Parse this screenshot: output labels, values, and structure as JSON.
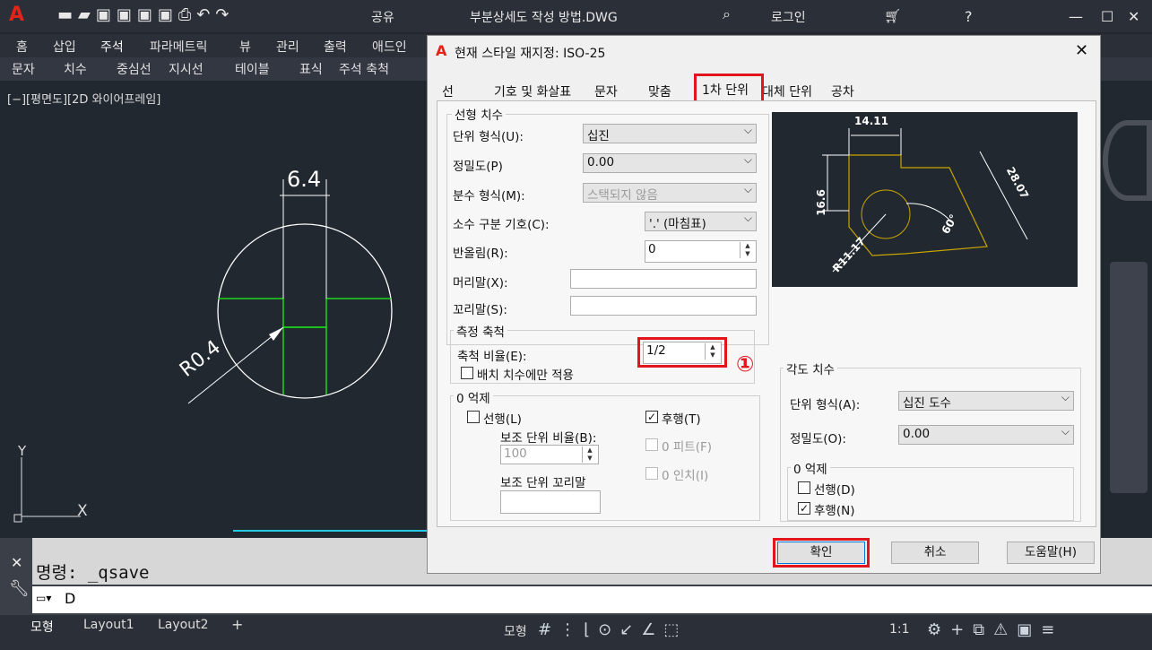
{
  "titlebar": {
    "app_logo": "A",
    "share": "공유",
    "filename": "부분상세도 작성 방법.DWG",
    "login": "로그인"
  },
  "ribbon": {
    "tabs": [
      "홈",
      "삽입",
      "주석",
      "파라메트릭",
      "뷰",
      "관리",
      "출력",
      "애드인"
    ],
    "panels": [
      "문자",
      "치수",
      "중심선",
      "지시선",
      "테이블",
      "표식",
      "주석 축척"
    ]
  },
  "viewport": {
    "label": "[−][평면도][2D 와이어프레임]",
    "dim_top": "6.4",
    "dim_radius": "R0.4",
    "axis_y": "Y",
    "axis_x": "X"
  },
  "command": {
    "history": "명령: _qsave",
    "input": "D"
  },
  "status": {
    "tabs": [
      "모형",
      "Layout1",
      "Layout2",
      "+"
    ],
    "model": "모형",
    "scale": "1:1"
  },
  "dialog": {
    "title": "현재 스타일 재지정: ISO-25",
    "tabs": [
      "선",
      "기호 및 화살표",
      "문자",
      "맞춤",
      "1차 단위",
      "대체 단위",
      "공차"
    ],
    "linear": {
      "title": "선형 치수",
      "unit_format_label": "단위 형식(U):",
      "unit_format": "십진",
      "precision_label": "정밀도(P)",
      "precision": "0.00",
      "fraction_label": "분수 형식(M):",
      "fraction": "스택되지 않음",
      "decimal_sep_label": "소수 구분 기호(C):",
      "decimal_sep": "'.' (마침표)",
      "roundoff_label": "반올림(R):",
      "roundoff": "0",
      "prefix_label": "머리말(X):",
      "suffix_label": "꼬리말(S):"
    },
    "scale": {
      "title": "측정 축척",
      "factor_label": "축척 비율(E):",
      "factor": "1/2",
      "layout_only": "배치 치수에만 적용",
      "marker": "①"
    },
    "zero": {
      "title": "0 억제",
      "leading": "선행(L)",
      "trailing": "후행(T)",
      "sub_factor_label": "보조 단위 비율(B):",
      "sub_factor": "100",
      "feet": "0 피트(F)",
      "inches": "0 인치(I)",
      "sub_suffix_label": "보조 단위 꼬리말"
    },
    "angular": {
      "title": "각도 치수",
      "unit_format_label": "단위 형식(A):",
      "unit_format": "십진 도수",
      "precision_label": "정밀도(O):",
      "precision": "0.00",
      "zero_title": "0 억제",
      "leading": "선행(D)",
      "trailing": "후행(N)"
    },
    "preview": {
      "d1": "14.11",
      "d2": "16.6",
      "d3": "28.07",
      "d4": "60°",
      "d5": "R11.17"
    },
    "buttons": {
      "ok": "확인",
      "cancel": "취소",
      "help": "도움말(H)"
    }
  }
}
